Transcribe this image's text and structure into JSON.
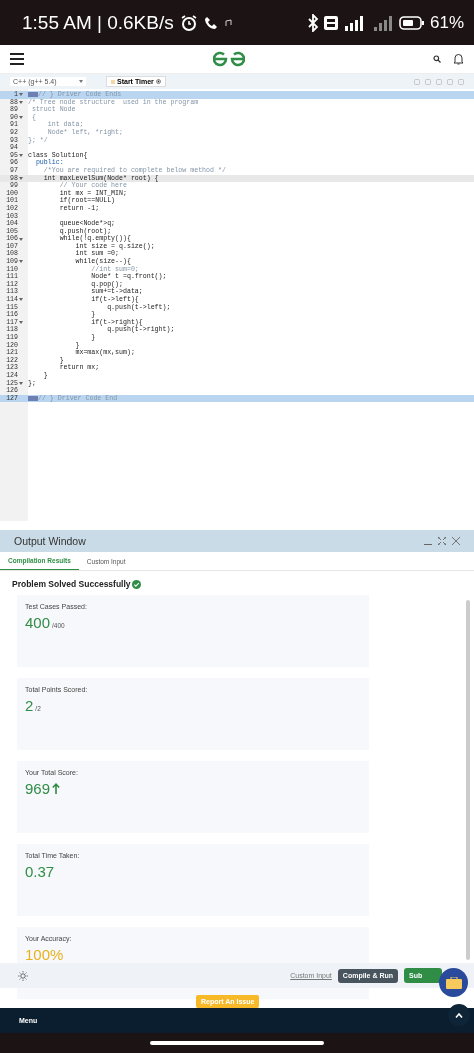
{
  "status_bar": {
    "time": "1:55 AM | 0.6KB/s",
    "battery": "61%"
  },
  "editor": {
    "language": "C++ (g++ 5.4)",
    "timer_button": "Start Timer",
    "lines": [
      {
        "num": "1",
        "fold": true,
        "selected": true,
        "active": false,
        "kind": "comment",
        "text": "// } Driver Code Ends"
      },
      {
        "num": "88",
        "fold": true,
        "selected": false,
        "active": false,
        "kind": "comment",
        "text": "/* Tree node structure  used in the program"
      },
      {
        "num": "89",
        "fold": false,
        "selected": false,
        "active": false,
        "kind": "comment",
        "text": " struct Node"
      },
      {
        "num": "90",
        "fold": true,
        "selected": false,
        "active": false,
        "kind": "comment",
        "text": " {"
      },
      {
        "num": "91",
        "fold": false,
        "selected": false,
        "active": false,
        "kind": "comment",
        "text": "     int data;"
      },
      {
        "num": "92",
        "fold": false,
        "selected": false,
        "active": false,
        "kind": "comment",
        "text": "     Node* left, *right;"
      },
      {
        "num": "93",
        "fold": false,
        "selected": false,
        "active": false,
        "kind": "comment",
        "text": "}; */"
      },
      {
        "num": "94",
        "fold": false,
        "selected": false,
        "active": false,
        "kind": "code"
      },
      {
        "num": "95",
        "fold": true,
        "selected": false,
        "active": false,
        "kind": "code",
        "text": "class Solution{"
      },
      {
        "num": "96",
        "fold": false,
        "selected": false,
        "active": false,
        "kind": "keyword",
        "text": "  public:"
      },
      {
        "num": "97",
        "fold": false,
        "selected": false,
        "active": false,
        "kind": "comment",
        "text": "    /*You are required to complete below method */"
      },
      {
        "num": "98",
        "fold": true,
        "selected": false,
        "active": true,
        "kind": "code",
        "text": "    int maxLevelSum(Node* root) {"
      },
      {
        "num": "99",
        "fold": false,
        "selected": false,
        "active": false,
        "kind": "comment",
        "text": "        // Your code here"
      },
      {
        "num": "100",
        "fold": false,
        "selected": false,
        "active": false,
        "kind": "code",
        "text": "        int mx = INT_MIN;"
      },
      {
        "num": "101",
        "fold": false,
        "selected": false,
        "active": false,
        "kind": "code",
        "text": "        if(root==NULL)"
      },
      {
        "num": "102",
        "fold": false,
        "selected": false,
        "active": false,
        "kind": "code",
        "text": "        return -1;"
      },
      {
        "num": "103",
        "fold": false,
        "selected": false,
        "active": false,
        "kind": "code"
      },
      {
        "num": "104",
        "fold": false,
        "selected": false,
        "active": false,
        "kind": "code",
        "text": "        queue<Node*>q;"
      },
      {
        "num": "105",
        "fold": false,
        "selected": false,
        "active": false,
        "kind": "code",
        "text": "        q.push(root);"
      },
      {
        "num": "106",
        "fold": true,
        "selected": false,
        "active": false,
        "kind": "code",
        "text": "        while(!q.empty()){"
      },
      {
        "num": "107",
        "fold": false,
        "selected": false,
        "active": false,
        "kind": "code",
        "text": "            int size = q.size();"
      },
      {
        "num": "108",
        "fold": false,
        "selected": false,
        "active": false,
        "kind": "code",
        "text": "            int sum =0;"
      },
      {
        "num": "109",
        "fold": true,
        "selected": false,
        "active": false,
        "kind": "code",
        "text": "            while(size--){"
      },
      {
        "num": "110",
        "fold": false,
        "selected": false,
        "active": false,
        "kind": "comment",
        "text": "                //int sum=0;"
      },
      {
        "num": "111",
        "fold": false,
        "selected": false,
        "active": false,
        "kind": "code",
        "text": "                Node* t =q.front();"
      },
      {
        "num": "112",
        "fold": false,
        "selected": false,
        "active": false,
        "kind": "code",
        "text": "                q.pop();"
      },
      {
        "num": "113",
        "fold": false,
        "selected": false,
        "active": false,
        "kind": "code",
        "text": "                sum+=t->data;"
      },
      {
        "num": "114",
        "fold": true,
        "selected": false,
        "active": false,
        "kind": "code",
        "text": "                if(t->left){"
      },
      {
        "num": "115",
        "fold": false,
        "selected": false,
        "active": false,
        "kind": "code",
        "text": "                    q.push(t->left);"
      },
      {
        "num": "116",
        "fold": false,
        "selected": false,
        "active": false,
        "kind": "code",
        "text": "                }"
      },
      {
        "num": "117",
        "fold": true,
        "selected": false,
        "active": false,
        "kind": "code",
        "text": "                if(t->right){"
      },
      {
        "num": "118",
        "fold": false,
        "selected": false,
        "active": false,
        "kind": "code",
        "text": "                    q.push(t->right);"
      },
      {
        "num": "119",
        "fold": false,
        "selected": false,
        "active": false,
        "kind": "code",
        "text": "                }"
      },
      {
        "num": "120",
        "fold": false,
        "selected": false,
        "active": false,
        "kind": "code",
        "text": "            }"
      },
      {
        "num": "121",
        "fold": false,
        "selected": false,
        "active": false,
        "kind": "code",
        "text": "            mx=max(mx,sum);"
      },
      {
        "num": "122",
        "fold": false,
        "selected": false,
        "active": false,
        "kind": "code",
        "text": "        }"
      },
      {
        "num": "123",
        "fold": false,
        "selected": false,
        "active": false,
        "kind": "code",
        "text": "        return mx;"
      },
      {
        "num": "124",
        "fold": false,
        "selected": false,
        "active": false,
        "kind": "code",
        "text": "    }"
      },
      {
        "num": "125",
        "fold": true,
        "selected": false,
        "active": false,
        "kind": "code",
        "text": "};"
      },
      {
        "num": "126",
        "fold": false,
        "selected": false,
        "active": false,
        "kind": "code"
      },
      {
        "num": "127",
        "fold": false,
        "selected": true,
        "active": false,
        "kind": "comment",
        "text": "// } Driver Code End"
      }
    ]
  },
  "output_window": {
    "title": "Output Window",
    "tabs": [
      {
        "label": "Compilation Results",
        "selected": true
      },
      {
        "label": "Custom Input",
        "selected": false
      }
    ],
    "result": "Problem Solved Successfully",
    "stats": [
      {
        "label": "Test Cases Passed:",
        "value": "400",
        "suffix": "/400",
        "color": "#2f8d46",
        "arrow": false
      },
      {
        "label": "Total Points Scored:",
        "value": "2",
        "suffix": "/2",
        "color": "#2f8d46",
        "arrow": false
      },
      {
        "label": "Your Total Score:",
        "value": "969",
        "color": "#2f8d46",
        "arrow": true
      },
      {
        "label": "Total Time Taken:",
        "value": "0.37",
        "color": "#2f8d46",
        "arrow": false
      },
      {
        "label": "Your Accuracy:",
        "value": "100%",
        "color": "#e8b21c",
        "arrow": false
      }
    ]
  },
  "actions": {
    "custom_input": "Custom Input",
    "compile": "Compile & Run",
    "submit": "Sub"
  },
  "report_button": "Report An Issue",
  "menu": "Menu"
}
